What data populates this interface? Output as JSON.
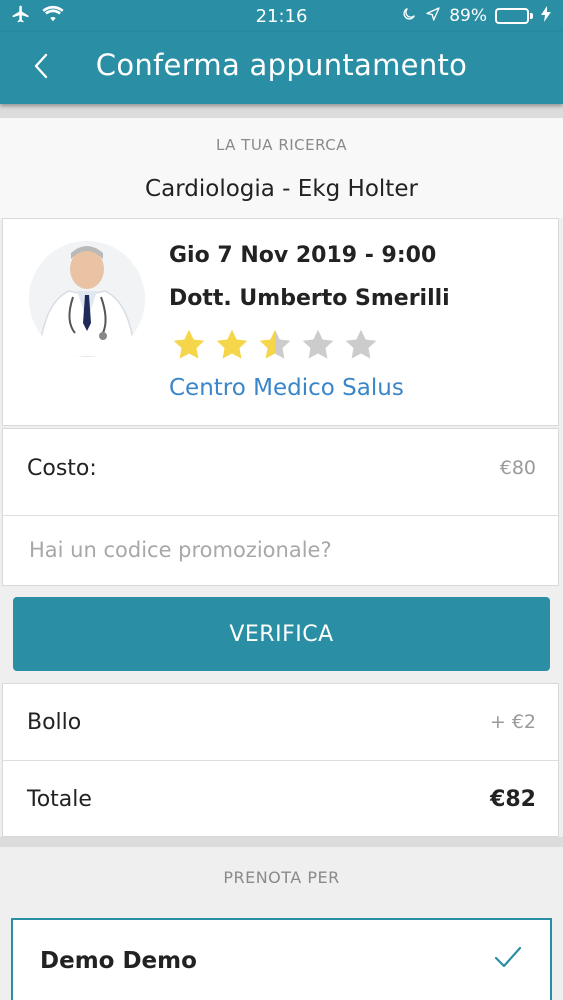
{
  "status_bar": {
    "time": "21:16",
    "battery_percent": "89%",
    "battery_level": 0.89,
    "icons": [
      "airplane-icon",
      "wifi-icon",
      "moon-icon",
      "location-arrow-icon",
      "battery-icon",
      "charging-bolt-icon"
    ]
  },
  "nav": {
    "back_icon": "chevron-left-icon",
    "title": "Conferma appuntamento"
  },
  "search": {
    "label": "LA TUA RICERCA",
    "value": "Cardiologia - Ekg Holter"
  },
  "appointment": {
    "date": "Gio 7 Nov 2019 - 9:00",
    "doctor": "Dott. Umberto Smerilli",
    "rating": 2.5,
    "rating_max": 5,
    "clinic": "Centro Medico Salus"
  },
  "cost": {
    "label": "Costo:",
    "value": "€80",
    "promo_placeholder": "Hai un codice promozionale?"
  },
  "verify_button": "VERIFICA",
  "totals": {
    "stamp_label": "Bollo",
    "stamp_value": "+ €2",
    "total_label": "Totale",
    "total_value": "€82"
  },
  "booking": {
    "label": "PRENOTA PER",
    "patient": "Demo Demo",
    "selected": true
  },
  "colors": {
    "accent": "#2a8ea4",
    "link": "#3a86c8",
    "star_filled": "#f5d64a",
    "star_empty": "#cccccc"
  }
}
